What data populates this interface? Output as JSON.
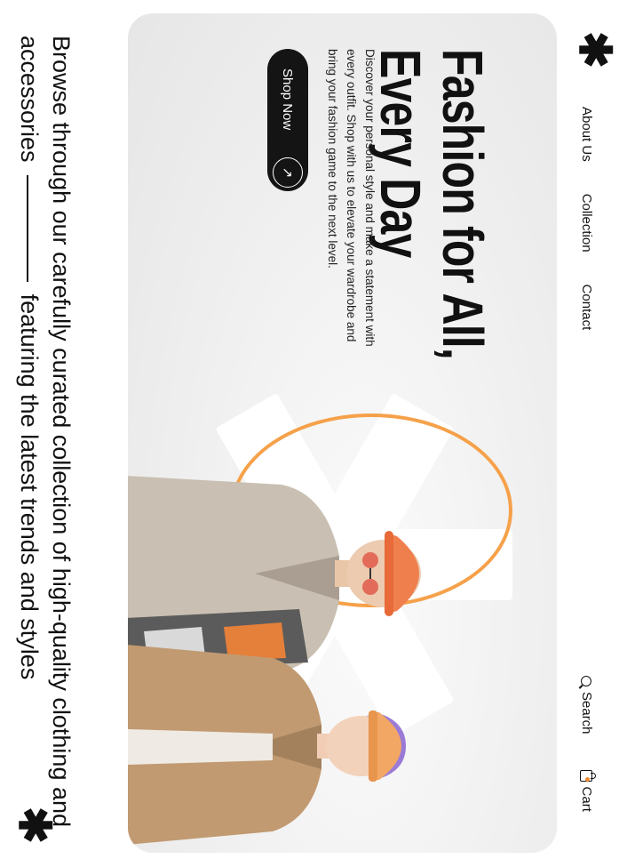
{
  "brand": {
    "logo_glyph": "✱"
  },
  "nav": {
    "about": "About Us",
    "collection": "Collection",
    "contact": "Contact",
    "search": "Search",
    "cart": "Cart"
  },
  "hero": {
    "title_line1": "Fashion for All,",
    "title_line2": "Every Day",
    "description": "Discover your personal style and make a statement with every outfit. Shop with us to elevate your wardrobe and bring your fashion game to the next level.",
    "cta_label": "Shop Now",
    "cta_icon": "↗"
  },
  "tagline": {
    "part1": "Browse through our carefully curated collection of high-quality clothing and accessories",
    "part2": "featuring the latest trends and styles"
  },
  "colors": {
    "accent": "#f6a14a",
    "dark": "#141414"
  }
}
